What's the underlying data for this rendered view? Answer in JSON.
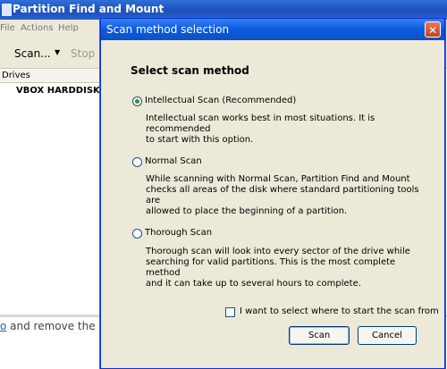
{
  "app": {
    "title": "Partition Find and Mount",
    "menu": [
      "File",
      "Actions",
      "Help"
    ],
    "toolbar": {
      "scan_label": "Scan...",
      "stop_label": "Stop S"
    },
    "drives_header": "Drives",
    "drive_name": "VBOX HARDDISK",
    "bottom_text_link": "o",
    "bottom_text_rest": " and remove the"
  },
  "dialog": {
    "title": "Scan method selection",
    "close_glyph": "✕",
    "heading": "Select scan method",
    "options": [
      {
        "label": "Intellectual Scan (Recommended)",
        "checked": true,
        "desc_line1": "Intellectual scan works best in most situations. It is recommended",
        "desc_line2": "to start with this option."
      },
      {
        "label": "Normal Scan",
        "checked": false,
        "desc_line1": "While scanning with Normal Scan, Partition Find and Mount",
        "desc_line2": "checks all areas of the disk where standard partitioning tools are",
        "desc_line3": "allowed to place the beginning of a partition."
      },
      {
        "label": "Thorough Scan",
        "checked": false,
        "desc_line1": "Thorough scan will look into every sector of the drive while",
        "desc_line2": "searching for valid partitions. This is the most complete method",
        "desc_line3": "and it can take up to several hours to complete."
      }
    ],
    "checkbox_label": "I want to select where to start the scan from",
    "scan_button": "Scan",
    "cancel_button": "Cancel"
  }
}
